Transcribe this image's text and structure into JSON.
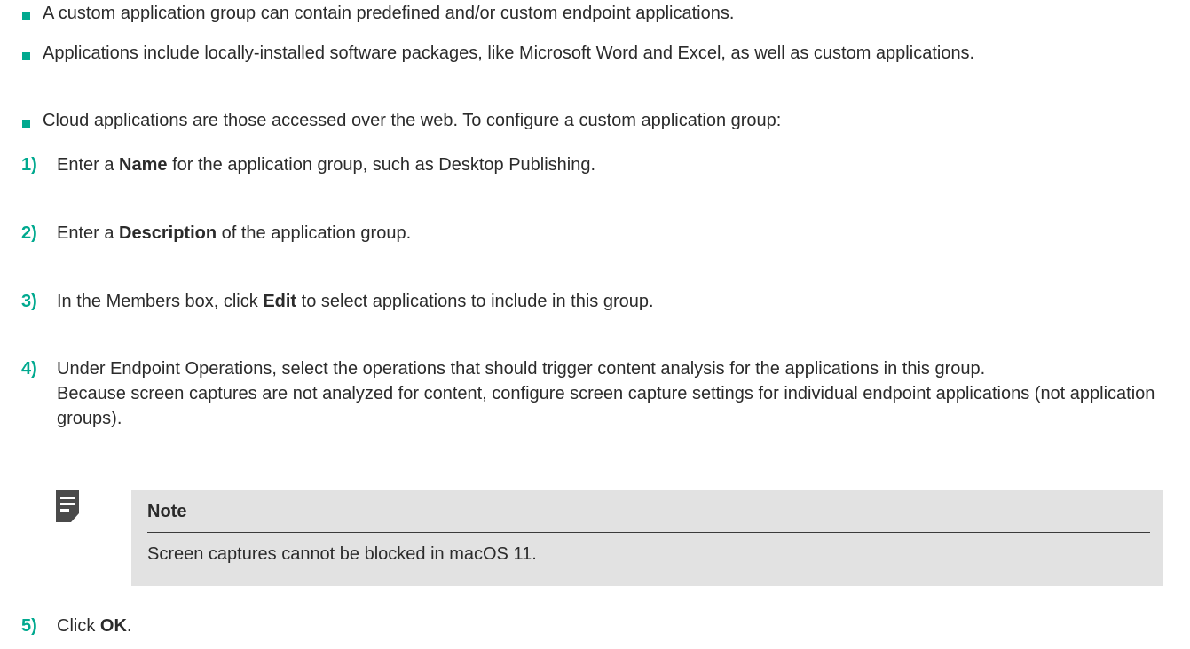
{
  "bullets": [
    "A custom application group can contain predefined and/or custom endpoint applications.",
    "Applications include locally-installed software packages, like Microsoft Word and Excel, as well as custom applications.",
    "Cloud applications are those accessed over the web. To configure a custom application group:"
  ],
  "steps": [
    {
      "num": "1)",
      "pre": "Enter a ",
      "bold": "Name",
      "post": " for the application group, such as Desktop Publishing."
    },
    {
      "num": "2)",
      "pre": "Enter a ",
      "bold": "Description",
      "post": " of the application group."
    },
    {
      "num": "3)",
      "pre": "In the Members box, click ",
      "bold": "Edit",
      "post": " to select applications to include in this group."
    },
    {
      "num": "4)",
      "text": "Under Endpoint Operations, select the operations that should trigger content analysis for the applications in this group.",
      "extra": "Because screen captures are not analyzed for content, configure screen capture settings for individual endpoint applications (not application groups)."
    },
    {
      "num": "5)",
      "pre": "Click ",
      "bold": "OK",
      "post": "."
    }
  ],
  "note": {
    "icon": "note-icon",
    "title": "Note",
    "text": "Screen captures cannot be blocked in macOS 11."
  },
  "colors": {
    "accent": "#00a98f",
    "text": "#2b2b2b",
    "note_bg": "#e2e2e2",
    "icon": "#4a4a4a"
  }
}
